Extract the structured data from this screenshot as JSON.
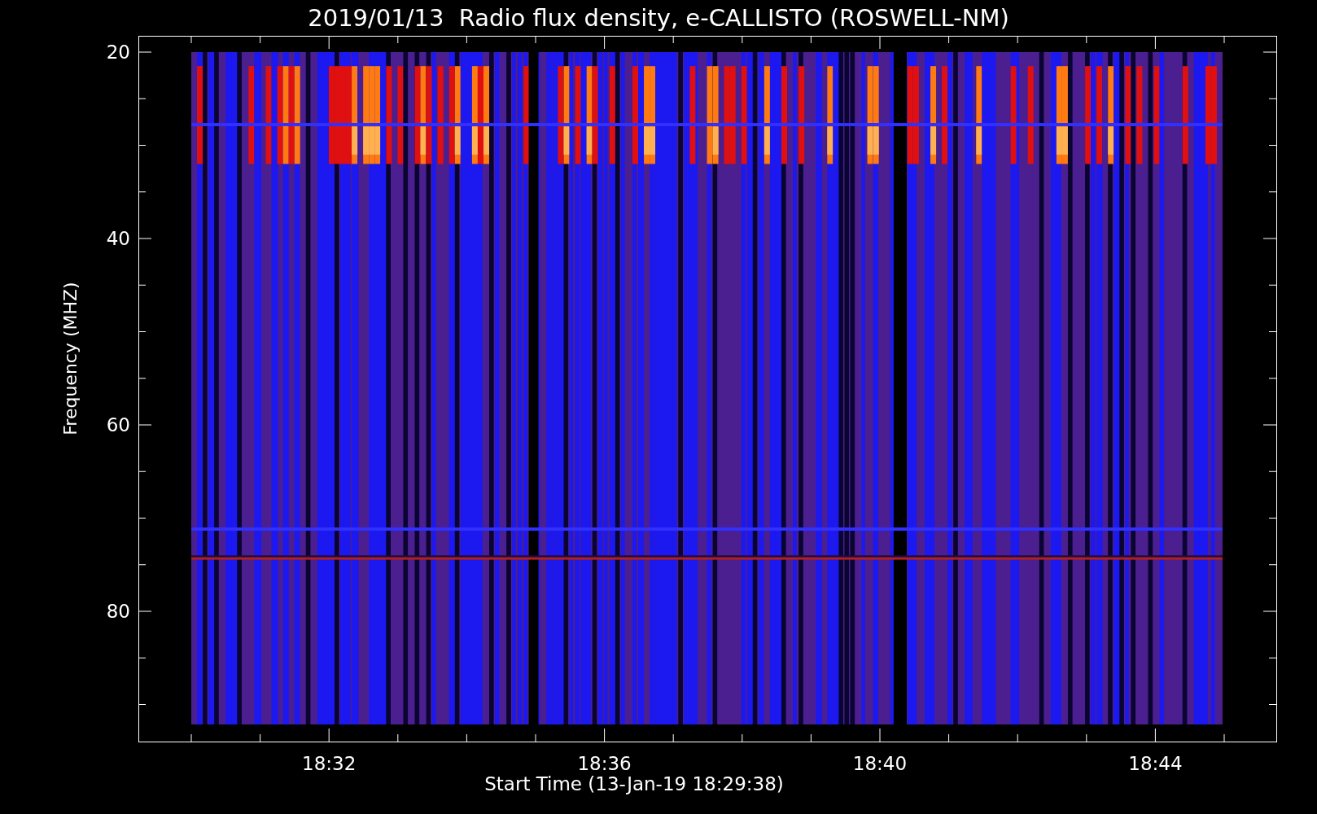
{
  "title": "2019/01/13  Radio flux density, e-CALLISTO (ROSWELL-NM)",
  "y_axis": {
    "label": "Frequency (MHZ)",
    "ticks": [
      "20",
      "40",
      "60",
      "80"
    ]
  },
  "x_axis": {
    "label": "Start Time (13-Jan-19 18:29:38)",
    "ticks": [
      "18:32",
      "18:36",
      "18:40",
      "18:44"
    ]
  }
}
